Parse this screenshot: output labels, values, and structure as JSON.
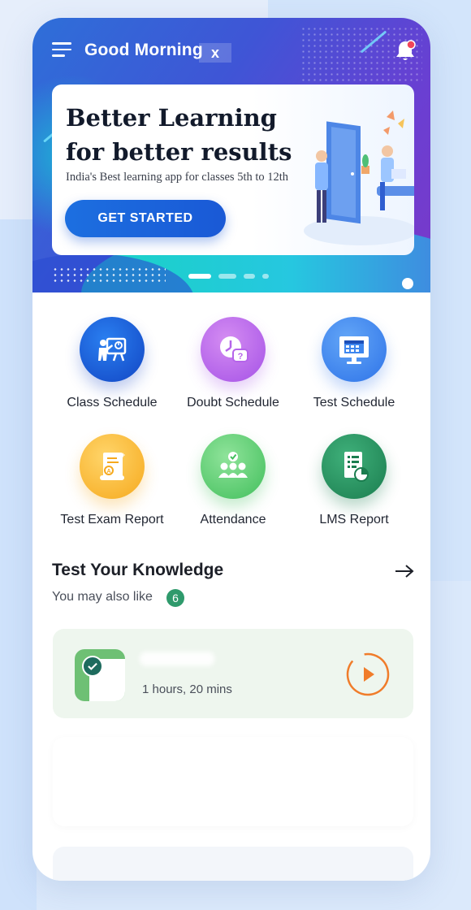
{
  "header": {
    "greeting": "Good Morning",
    "close_label": "x"
  },
  "banner": {
    "title_line1": "Better Learning",
    "title_line2": "for better results",
    "subtitle": "India's Best learning app for classes 5th to 12th",
    "cta_label": "GET STARTED",
    "pager": {
      "count": 4,
      "active_index": 0
    }
  },
  "quick_actions": [
    {
      "label": "Class Schedule",
      "icon": "presentation-icon",
      "color": "#1a5fd8"
    },
    {
      "label": "Doubt Schedule",
      "icon": "clock-question-icon",
      "color": "#b564ea"
    },
    {
      "label": "Test Schedule",
      "icon": "monitor-calendar-icon",
      "color": "#3d86ef"
    },
    {
      "label": "Test Exam Report",
      "icon": "certificate-icon",
      "color": "#f8b330"
    },
    {
      "label": "Attendance",
      "icon": "group-check-icon",
      "color": "#55c867"
    },
    {
      "label": "LMS Report",
      "icon": "report-chart-icon",
      "color": "#268c5c"
    }
  ],
  "knowledge": {
    "title": "Test Your Knowledge",
    "subtitle": "You may also like",
    "count": "6",
    "card": {
      "duration": "1 hours, 20 mins",
      "progress_color": "#f07c2a"
    }
  },
  "colors": {
    "accent_blue": "#1c6fe0",
    "badge_green": "#2f9a6c",
    "card_bg": "#eef6ee"
  }
}
